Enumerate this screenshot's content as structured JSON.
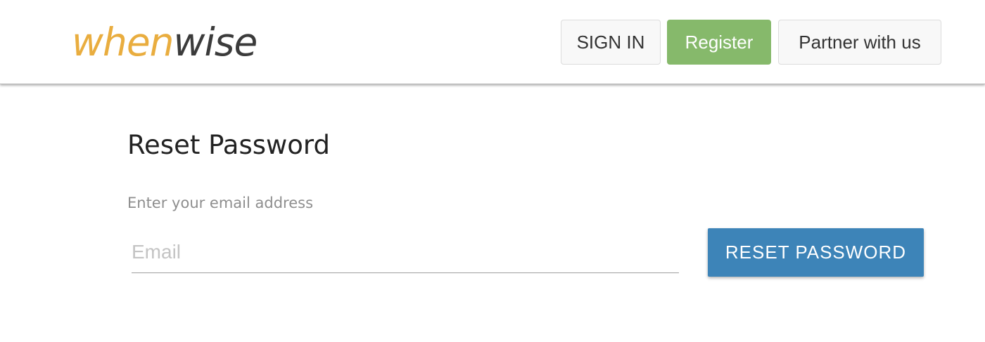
{
  "header": {
    "logo": {
      "part1": "when",
      "part2": "wise",
      "part1_color": "#e9ad3f",
      "part2_color": "#3b3b3b"
    },
    "nav": {
      "sign_in_label": "SIGN IN",
      "register_label": "Register",
      "partner_label": "Partner with us"
    },
    "colors": {
      "register_bg": "#86b96b"
    }
  },
  "main": {
    "title": "Reset Password",
    "email_label": "Enter your email address",
    "email_value": "",
    "email_placeholder": "Email",
    "submit_label": "RESET PASSWORD",
    "colors": {
      "submit_bg": "#3d84b8"
    }
  }
}
